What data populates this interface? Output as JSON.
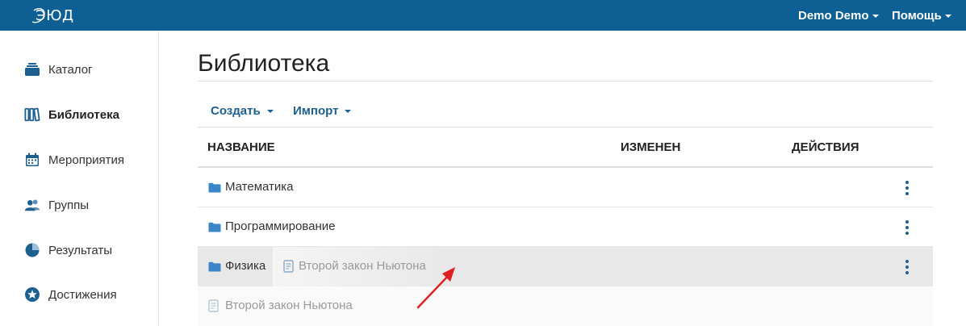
{
  "app": {
    "logo": "ЭЮД"
  },
  "topbar": {
    "user_menu": "Demo Demo",
    "help_menu": "Помощь"
  },
  "sidebar": {
    "items": [
      {
        "label": "Каталог",
        "icon": "catalog-icon",
        "active": false
      },
      {
        "label": "Библиотека",
        "icon": "library-icon",
        "active": true
      },
      {
        "label": "Мероприятия",
        "icon": "calendar-icon",
        "active": false
      },
      {
        "label": "Группы",
        "icon": "users-icon",
        "active": false
      },
      {
        "label": "Результаты",
        "icon": "pie-chart-icon",
        "active": false
      },
      {
        "label": "Достижения",
        "icon": "star-icon",
        "active": false
      }
    ]
  },
  "main": {
    "title": "Библиотека",
    "toolbar": {
      "create_label": "Создать",
      "import_label": "Импорт"
    },
    "table": {
      "columns": [
        "НАЗВАНИЕ",
        "ИЗМЕНЕН",
        "ДЕЙСТВИЯ"
      ],
      "rows": [
        {
          "name": "Математика",
          "type": "folder"
        },
        {
          "name": "Программирование",
          "type": "folder"
        },
        {
          "name": "Физика",
          "type": "folder",
          "drop_target": true
        }
      ]
    },
    "drag": {
      "item_label": "Второй закон Ньютона",
      "ghost_label": "Второй закон Ньютона"
    }
  },
  "colors": {
    "topbar": "#0e5f93",
    "accent": "#1d5f8f",
    "folder": "#3a86c8",
    "annotation_arrow": "#e02020"
  }
}
